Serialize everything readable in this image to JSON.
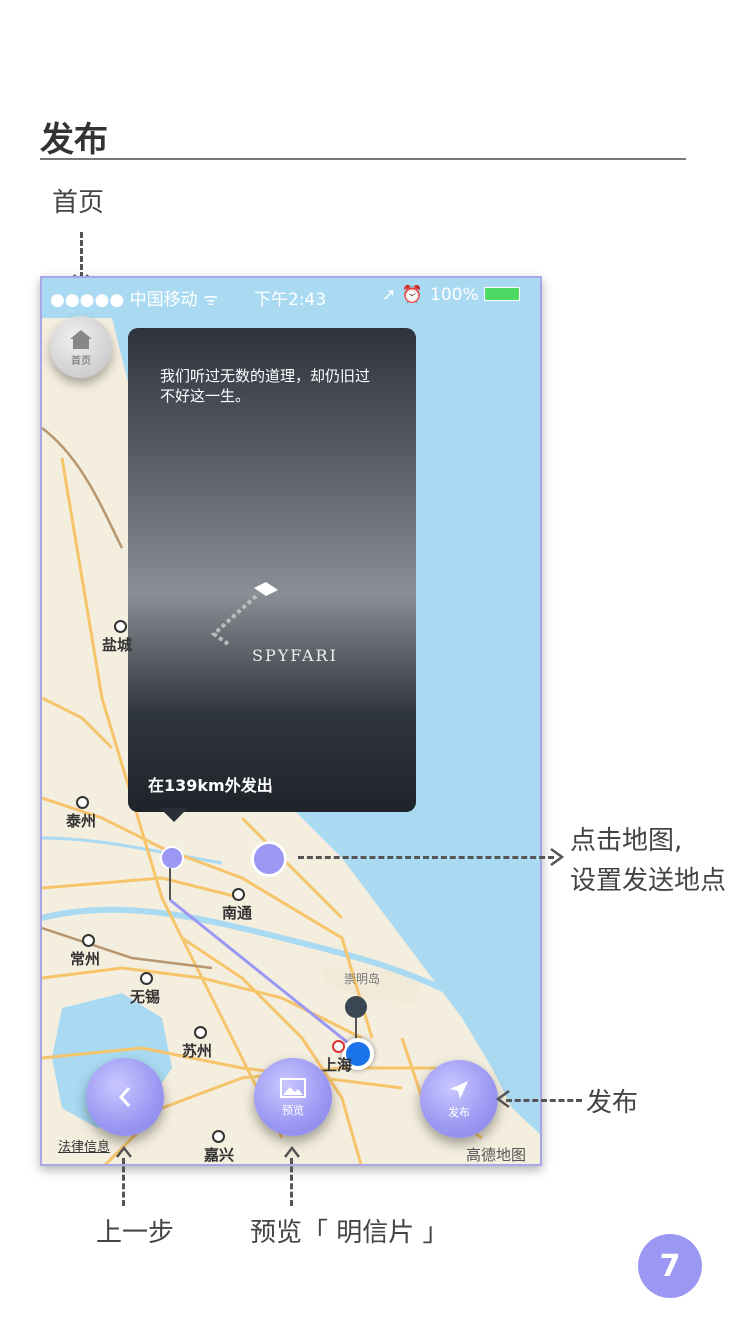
{
  "page": {
    "title": "发布",
    "page_number": "7"
  },
  "annotations": {
    "home": "首页",
    "tap_map_line1": "点击地图,",
    "tap_map_line2": "设置发送地点",
    "publish": "发布",
    "back": "上一步",
    "preview": "预览「 明信片 」"
  },
  "status_bar": {
    "signal": "●●●●● 中国移动 ᯤ",
    "time": "下午2:43",
    "battery": "100%"
  },
  "home_button": {
    "label": "首页",
    "icon": "home-icon"
  },
  "postcard": {
    "quote": "我们听过无数的道理，却仍旧过不好这一生。",
    "brand": "SPYFARI",
    "distance": "在139km外发出"
  },
  "map": {
    "cities": [
      "盐城",
      "泰州",
      "南通",
      "常州",
      "无锡",
      "苏州",
      "上海",
      "嘉兴",
      "崇明岛"
    ],
    "legal": "法律信息",
    "provider": "高德地图"
  },
  "bottom_bar": {
    "back": {
      "icon": "chevron-left-icon"
    },
    "preview": {
      "label": "预览",
      "icon": "image-icon"
    },
    "publish": {
      "label": "发布",
      "icon": "send-icon"
    }
  },
  "colors": {
    "accent": "#9b98f4",
    "sea": "#a9daf2",
    "land": "#f4eedf",
    "road": "#f6c46a"
  }
}
